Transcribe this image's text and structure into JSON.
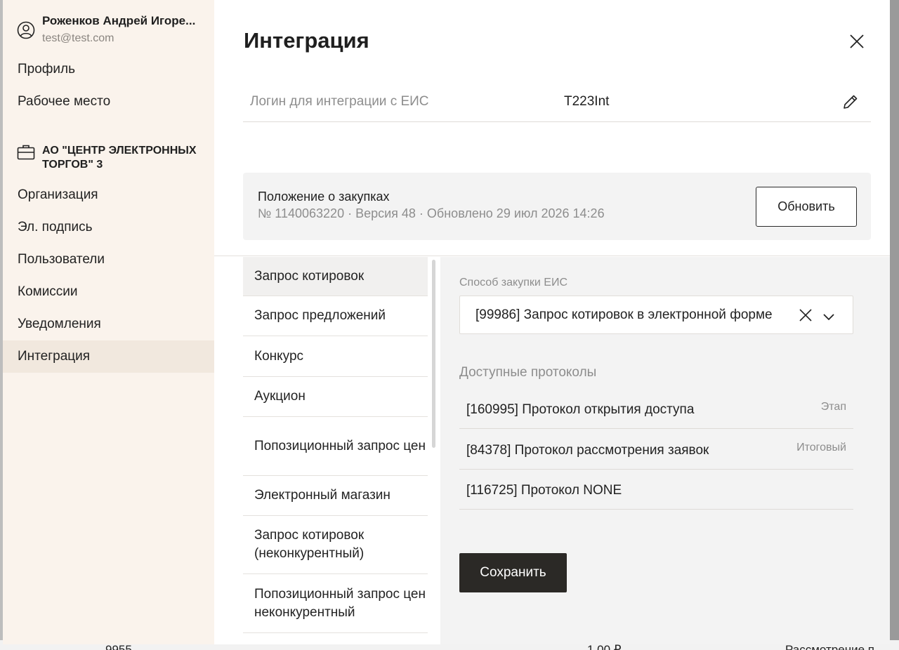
{
  "user": {
    "name": "Роженков Андрей Игоре...",
    "email": "test@test.com"
  },
  "sidebar": {
    "personal_items": [
      {
        "label": "Профиль"
      },
      {
        "label": "Рабочее место"
      }
    ],
    "organization": "АО \"ЦЕНТР ЭЛЕКТРОННЫХ ТОРГОВ\" 3",
    "org_items": [
      {
        "label": "Организация"
      },
      {
        "label": "Эл. подпись"
      },
      {
        "label": "Пользователи"
      },
      {
        "label": "Комиссии"
      },
      {
        "label": "Уведомления"
      },
      {
        "label": "Интеграция",
        "active": true
      }
    ]
  },
  "modal": {
    "title": "Интеграция",
    "login_label": "Логин для интеграции с ЕИС",
    "login_value": "T223Int",
    "regulation": {
      "title": "Положение о закупках",
      "meta": "№ 1140063220 · Версия 48 · Обновлено 29 июл 2026 14:26",
      "refresh_label": "Обновить"
    }
  },
  "methods": [
    {
      "label": "Запрос котировок",
      "active": true
    },
    {
      "label": "Запрос предложений"
    },
    {
      "label": "Конкурс"
    },
    {
      "label": "Аукцион"
    },
    {
      "label": "Попозиционный запрос цен"
    },
    {
      "label": "Электронный магазин"
    },
    {
      "label": "Запрос котировок (неконкурентный)"
    },
    {
      "label": "Попозиционный запрос цен неконкурентный"
    }
  ],
  "details": {
    "method_field_label": "Способ закупки ЕИС",
    "method_value": "[99986] Запрос котировок в электронной форме",
    "protocols_label": "Доступные протоколы",
    "protocols": [
      {
        "name": "[160995] Протокол открытия доступа",
        "tag": "Этап"
      },
      {
        "name": "[84378] Протокол рассмотрения заявок",
        "tag": "Итоговый"
      },
      {
        "name": "[116725] Протокол NONE",
        "tag": ""
      }
    ],
    "save_label": "Сохранить"
  },
  "background": {
    "texts": [
      "9955",
      "1 00 ₽",
      "Рассмотрение п"
    ]
  },
  "colors": {
    "sidebar_bg": "#faf3ec",
    "active_item_bg": "#f1e8de",
    "panel_bg": "#f3f3f3",
    "primary_button": "#2b2926"
  }
}
